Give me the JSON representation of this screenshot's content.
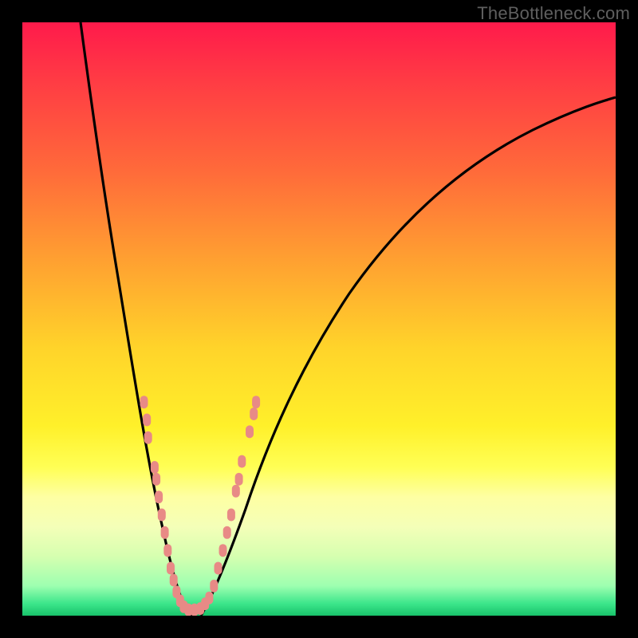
{
  "watermark": "TheBottleneck.com",
  "colors": {
    "background": "#000000",
    "gradient_top": "#ff1a4b",
    "gradient_mid": "#ffd42a",
    "gradient_bottom": "#19c36b",
    "curve": "#000000",
    "dots": "#e88a86"
  },
  "chart_data": {
    "type": "line",
    "title": "",
    "xlabel": "",
    "ylabel": "",
    "xlim": [
      0,
      100
    ],
    "ylim": [
      0,
      100
    ],
    "note": "Axes unlabeled; values are approximate pixel-relative percentages of the plot area.",
    "series": [
      {
        "name": "left-branch",
        "x": [
          10,
          12,
          14,
          16,
          18,
          20,
          22,
          24,
          26,
          27
        ],
        "y": [
          100,
          82,
          66,
          52,
          40,
          30,
          20,
          10,
          3,
          0
        ]
      },
      {
        "name": "right-branch",
        "x": [
          30,
          32,
          35,
          40,
          46,
          55,
          65,
          78,
          90,
          100
        ],
        "y": [
          0,
          5,
          12,
          22,
          32,
          44,
          55,
          65,
          73,
          78
        ]
      }
    ],
    "scatter_overlay": {
      "name": "pink-dots",
      "note": "Clusters of dots overlaid on both branches near the bottom of the V.",
      "points": [
        {
          "x": 20.5,
          "y": 36
        },
        {
          "x": 21,
          "y": 33
        },
        {
          "x": 21.2,
          "y": 30
        },
        {
          "x": 22.3,
          "y": 25
        },
        {
          "x": 22.6,
          "y": 23
        },
        {
          "x": 23,
          "y": 20
        },
        {
          "x": 23.5,
          "y": 17
        },
        {
          "x": 24,
          "y": 14
        },
        {
          "x": 24.5,
          "y": 11
        },
        {
          "x": 25,
          "y": 8
        },
        {
          "x": 25.5,
          "y": 6
        },
        {
          "x": 26,
          "y": 4
        },
        {
          "x": 26.6,
          "y": 2.5
        },
        {
          "x": 27.2,
          "y": 1.5
        },
        {
          "x": 28,
          "y": 1
        },
        {
          "x": 29,
          "y": 1
        },
        {
          "x": 30,
          "y": 1.2
        },
        {
          "x": 30.8,
          "y": 2
        },
        {
          "x": 31.5,
          "y": 3
        },
        {
          "x": 32.3,
          "y": 5
        },
        {
          "x": 33,
          "y": 8
        },
        {
          "x": 33.8,
          "y": 11
        },
        {
          "x": 34.5,
          "y": 14
        },
        {
          "x": 35.2,
          "y": 17
        },
        {
          "x": 36,
          "y": 21
        },
        {
          "x": 36.5,
          "y": 23
        },
        {
          "x": 37,
          "y": 26
        },
        {
          "x": 38.3,
          "y": 31
        },
        {
          "x": 39,
          "y": 34
        },
        {
          "x": 39.4,
          "y": 36
        }
      ]
    }
  }
}
